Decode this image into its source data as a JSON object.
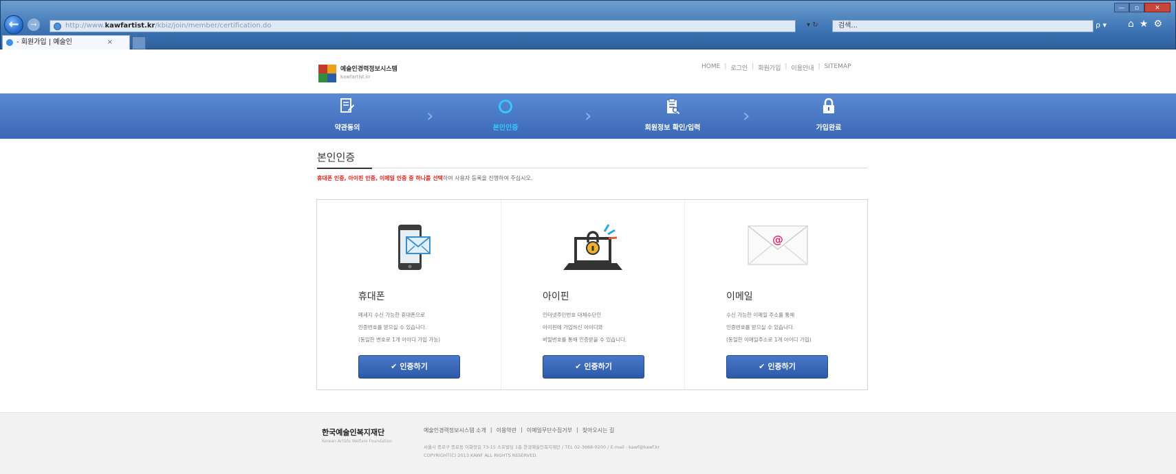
{
  "browser": {
    "url_prefix": "http://www.",
    "url_host": "kawfartist.kr",
    "url_path": "/kbiz/join/member/certification.do",
    "addr_controls": "▾ ↻",
    "search_placeholder": "검색...",
    "search_button": "ρ ▾",
    "toolbar_icons": "⌂★⚙",
    "tab_title": "- 회원가입 | 예술인",
    "tab_close": "×",
    "win_min": "—",
    "win_max": "▫",
    "win_close": "✕"
  },
  "header": {
    "logo_title": "예술인경력정보시스템",
    "logo_sub": "kawfartist.kr",
    "util_nav": [
      "HOME",
      "로그인",
      "회원가입",
      "이용안내",
      "SITEMAP"
    ]
  },
  "steps": [
    {
      "label": "약관동의",
      "icon": "document-edit-icon"
    },
    {
      "label": "본인인증",
      "icon": "circle-icon",
      "active": true
    },
    {
      "label": "회원정보 확인/입력",
      "icon": "clipboard-search-icon"
    },
    {
      "label": "가입완료",
      "icon": "lock-icon"
    }
  ],
  "section": {
    "title": "본인인증",
    "desc_highlight": "휴대폰 인증, 아이핀 인증, 이메일 인증 중 하나를 선택",
    "desc_rest": "하여 사용자 등록을 진행하여 주십시오."
  },
  "cards": [
    {
      "title": "휴대폰",
      "lines": [
        "메세지 수신 가능한 휴대폰으로",
        "인증번호를 받으실 수 있습니다.",
        "(동일한 번호로 1개 아이디 가입 가능)"
      ],
      "button": "인증하기"
    },
    {
      "title": "아이핀",
      "lines": [
        "인터넷주민번호 대체수단인",
        "아이핀에 가입하신 아이디와",
        "비밀번호를 통해 인증받을 수 있습니다."
      ],
      "button": "인증하기"
    },
    {
      "title": "이메일",
      "lines": [
        "수신 가능한 이메일 주소를 통해",
        "인증번호를 받으실 수 있습니다.",
        "(동일한 이메일주소로 1개 아이디 가입)"
      ],
      "button": "인증하기"
    }
  ],
  "footer": {
    "org": "한국예술인복지재단",
    "org_sub": "Korean Artists Welfare Foundation",
    "links": [
      "예술인경력정보시스템 소개",
      "이용약관",
      "이메일무단수집거부",
      "찾아오시는 길"
    ],
    "address": "서울시 종로구 종로동 이화장길 73-15 소호빌딩 1층 한국예술인복지재단 / TEL 02-3668-0200 / E-mail : kawf@kawf.kr",
    "copyright": "COPYRIGHT(C) 2013 KAWF ALL RIGHTS RESERVED."
  },
  "colors": {
    "steps_bar": "#3a68b6",
    "active_step": "#33c8ff",
    "highlight": "#e0251b",
    "button": "#2d5aa8"
  }
}
